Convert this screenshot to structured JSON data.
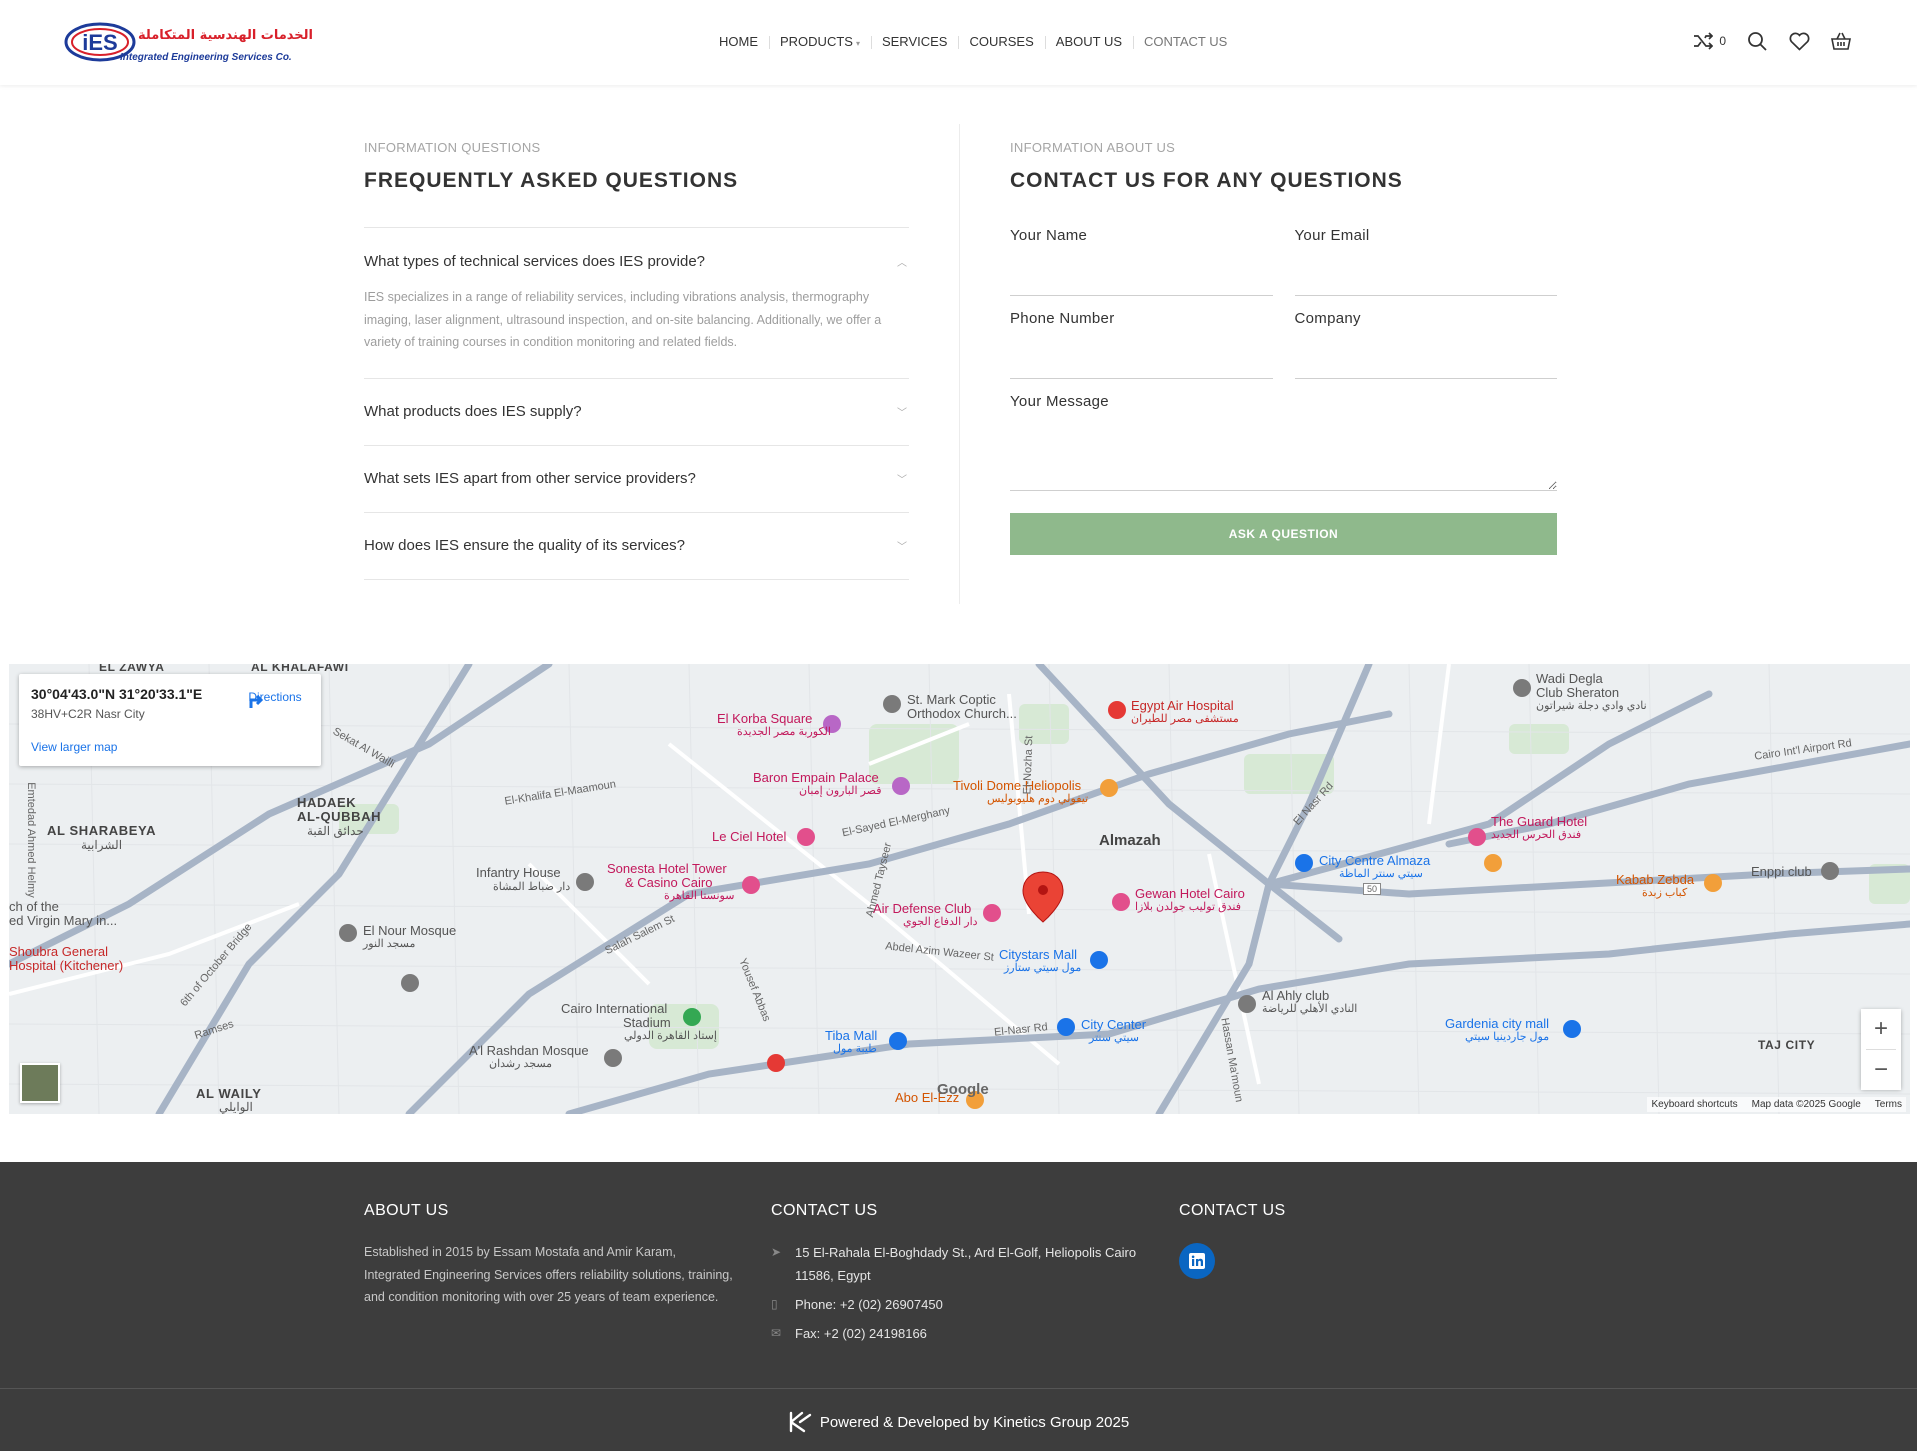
{
  "header": {
    "logo_arabic": "الخدمات الهندسية المتكاملة",
    "logo_mark": "iES",
    "logo_english": "Integrated Engineering Services Co.",
    "nav": [
      {
        "label": "HOME"
      },
      {
        "label": "PRODUCTS"
      },
      {
        "label": "SERVICES"
      },
      {
        "label": "COURSES"
      },
      {
        "label": "ABOUT US"
      },
      {
        "label": "CONTACT US"
      }
    ],
    "compare_count": "0",
    "icons": [
      "shuffle-icon",
      "search-icon",
      "heart-icon",
      "basket-icon"
    ]
  },
  "faq": {
    "eyebrow": "INFORMATION QUESTIONS",
    "title": "FREQUENTLY ASKED QUESTIONS",
    "items": [
      {
        "question": "What types of technical services does IES provide?",
        "answer": "IES specializes in a range of reliability services, including vibrations analysis, thermography imaging, laser alignment, ultrasound inspection, and on-site balancing. Additionally, we offer a variety of training courses in condition monitoring and related fields.",
        "expanded": true
      },
      {
        "question": "What products does IES supply?",
        "expanded": false
      },
      {
        "question": "What sets IES apart from other service providers?",
        "expanded": false
      },
      {
        "question": "How does IES ensure the quality of its services?",
        "expanded": false
      }
    ]
  },
  "contact": {
    "eyebrow": "INFORMATION ABOUT US",
    "title": "CONTACT US FOR ANY QUESTIONS",
    "fields": {
      "name": "Your Name",
      "email": "Your Email",
      "phone": "Phone Number",
      "company": "Company",
      "message": "Your Message"
    },
    "submit": "ASK A QUESTION",
    "accent_color": "#8fb98c"
  },
  "map": {
    "coords": "30°04'43.0\"N 31°20'33.1\"E",
    "plus_code": "38HV+C2R Nasr City",
    "directions": "Directions",
    "larger_map": "View larger map",
    "attribution": {
      "shortcuts": "Keyboard shortcuts",
      "data": "Map data ©2025 Google",
      "terms": "Terms"
    },
    "google": "Google",
    "labels": {
      "almazah": "Almazah",
      "hadaek1": "HADAEK",
      "hadaek2": "AL-QUBBAH",
      "hadaek_ar": "حدائق القبة",
      "sharabeya": "AL SHARABEYA",
      "sharabeya_ar": "الشرابية",
      "taj": "TAJ CITY",
      "waily": "AL WAILY",
      "waily_ar": "الوايلي",
      "zawya": "EL ZAWYA",
      "khalafawi": "AL KHALAFAWI",
      "korba": "El Korba Square",
      "korba_ar": "الكوربة مصر الجديدة",
      "markcoptic1": "St. Mark Coptic",
      "markcoptic2": "Orthodox Church...",
      "egyptair": "Egypt Air Hospital",
      "egyptair_ar": "مستشفى مصر للطيران",
      "wadi1": "Wadi Degla",
      "wadi2": "Club Sheraton",
      "wadi_ar": "نادي وادي دجلة شيراتون",
      "baron": "Baron Empain Palace",
      "baron_ar": "قصر البارون إمبان",
      "tivoli": "Tivoli Dome Heliopolis",
      "tivoli_ar": "تيفولي دوم هليوبوليس",
      "leciel": "Le Ciel Hotel",
      "guard": "The Guard Hotel",
      "guard_ar": "فندق الحرس الجديد",
      "citycentre": "City Centre Almaza",
      "citycentre_ar": "سيتي سنتر الماظة",
      "kabab": "Kabab Zebda",
      "kabab_ar": "كباب زبدة",
      "enppi": "Enppi club",
      "sonesta1": "Sonesta Hotel Tower",
      "sonesta2": "& Casino Cairo",
      "sonesta_ar": "سونستا القاهرة",
      "infantry1": "Infantry House",
      "infantry_ar": "دار ضباط المشاة",
      "gewan": "Gewan Hotel Cairo",
      "gewan_ar": "فندق توليب جولدن بلازا",
      "airdefense": "Air Defense Club",
      "airdefense_ar": "دار الدفاع الجوي",
      "citystars": "Citystars Mall",
      "citystars_ar": "مول سيتي ستارز",
      "nour": "El Nour Mosque",
      "nour_ar": "مسجد النور",
      "virgin1": "ch of the",
      "virgin2": "ed Virgin Mary in...",
      "shoubra1": "Shoubra General",
      "shoubra2": "Hospital (Kitchener)",
      "stadium1": "Cairo International",
      "stadium2": "Stadium",
      "stadium_ar": "إستاد القاهرة الدولي",
      "rashdan": "A'l Rashdan Mosque",
      "rashdan_ar": "مسجد رشدان",
      "tiba": "Tiba Mall",
      "tiba_ar": "طيبة مول",
      "citycenter": "City Center",
      "citycenter_ar": "سيتي سنتر",
      "ahly1": "Al Ahly club",
      "ahly_ar": "النادي الأهلي للرياضة",
      "gardenia": "Gardenia city mall",
      "gardenia_ar": "مول جاردينيا سيتي",
      "abo": "Abo El-Ezz",
      "road_nasr": "El-Nasr Rd",
      "road_nasr2": "El Nasr Rd",
      "road_salah": "Salah Salem St",
      "road_sayed": "El-Sayed El-Merghany",
      "road_abdel": "Abdel Azim Wazeer St",
      "road_khalifa": "El-Khalifa El-Maamoun",
      "road_october": "6th of October Bridge",
      "road_airport": "Cairo Int'l Airport Rd",
      "road_nozha": "El-Nozha St",
      "road_ramses": "Ramses",
      "road_yousef": "Yousef Abbas",
      "road_tayseer": "Ahmed Tayseer",
      "road_marghany": "El-Merghany",
      "road_hassan": "Hassan Ma'moun",
      "road_emtedad": "Emtedad Ahmed Helmy",
      "road_sekat": "Sekat Al Wailli",
      "road_50": "50"
    }
  },
  "footer": {
    "about_title": "ABOUT US",
    "about_text": "Established in 2015 by Essam Mostafa and Amir Karam, Integrated Engineering Services offers reliability solutions, training, and condition monitoring with over 25 years of team experience.",
    "contact_title": "CONTACT US",
    "address": "15 El-Rahala El-Boghdady St., Ard El-Golf, Heliopolis Cairo 11586, Egypt",
    "phone": "Phone: +2 (02) 26907450",
    "fax": "Fax: +2 (02) 24198166",
    "social_title": "CONTACT US",
    "powered": "Powered & Developed by Kinetics Group 2025"
  }
}
